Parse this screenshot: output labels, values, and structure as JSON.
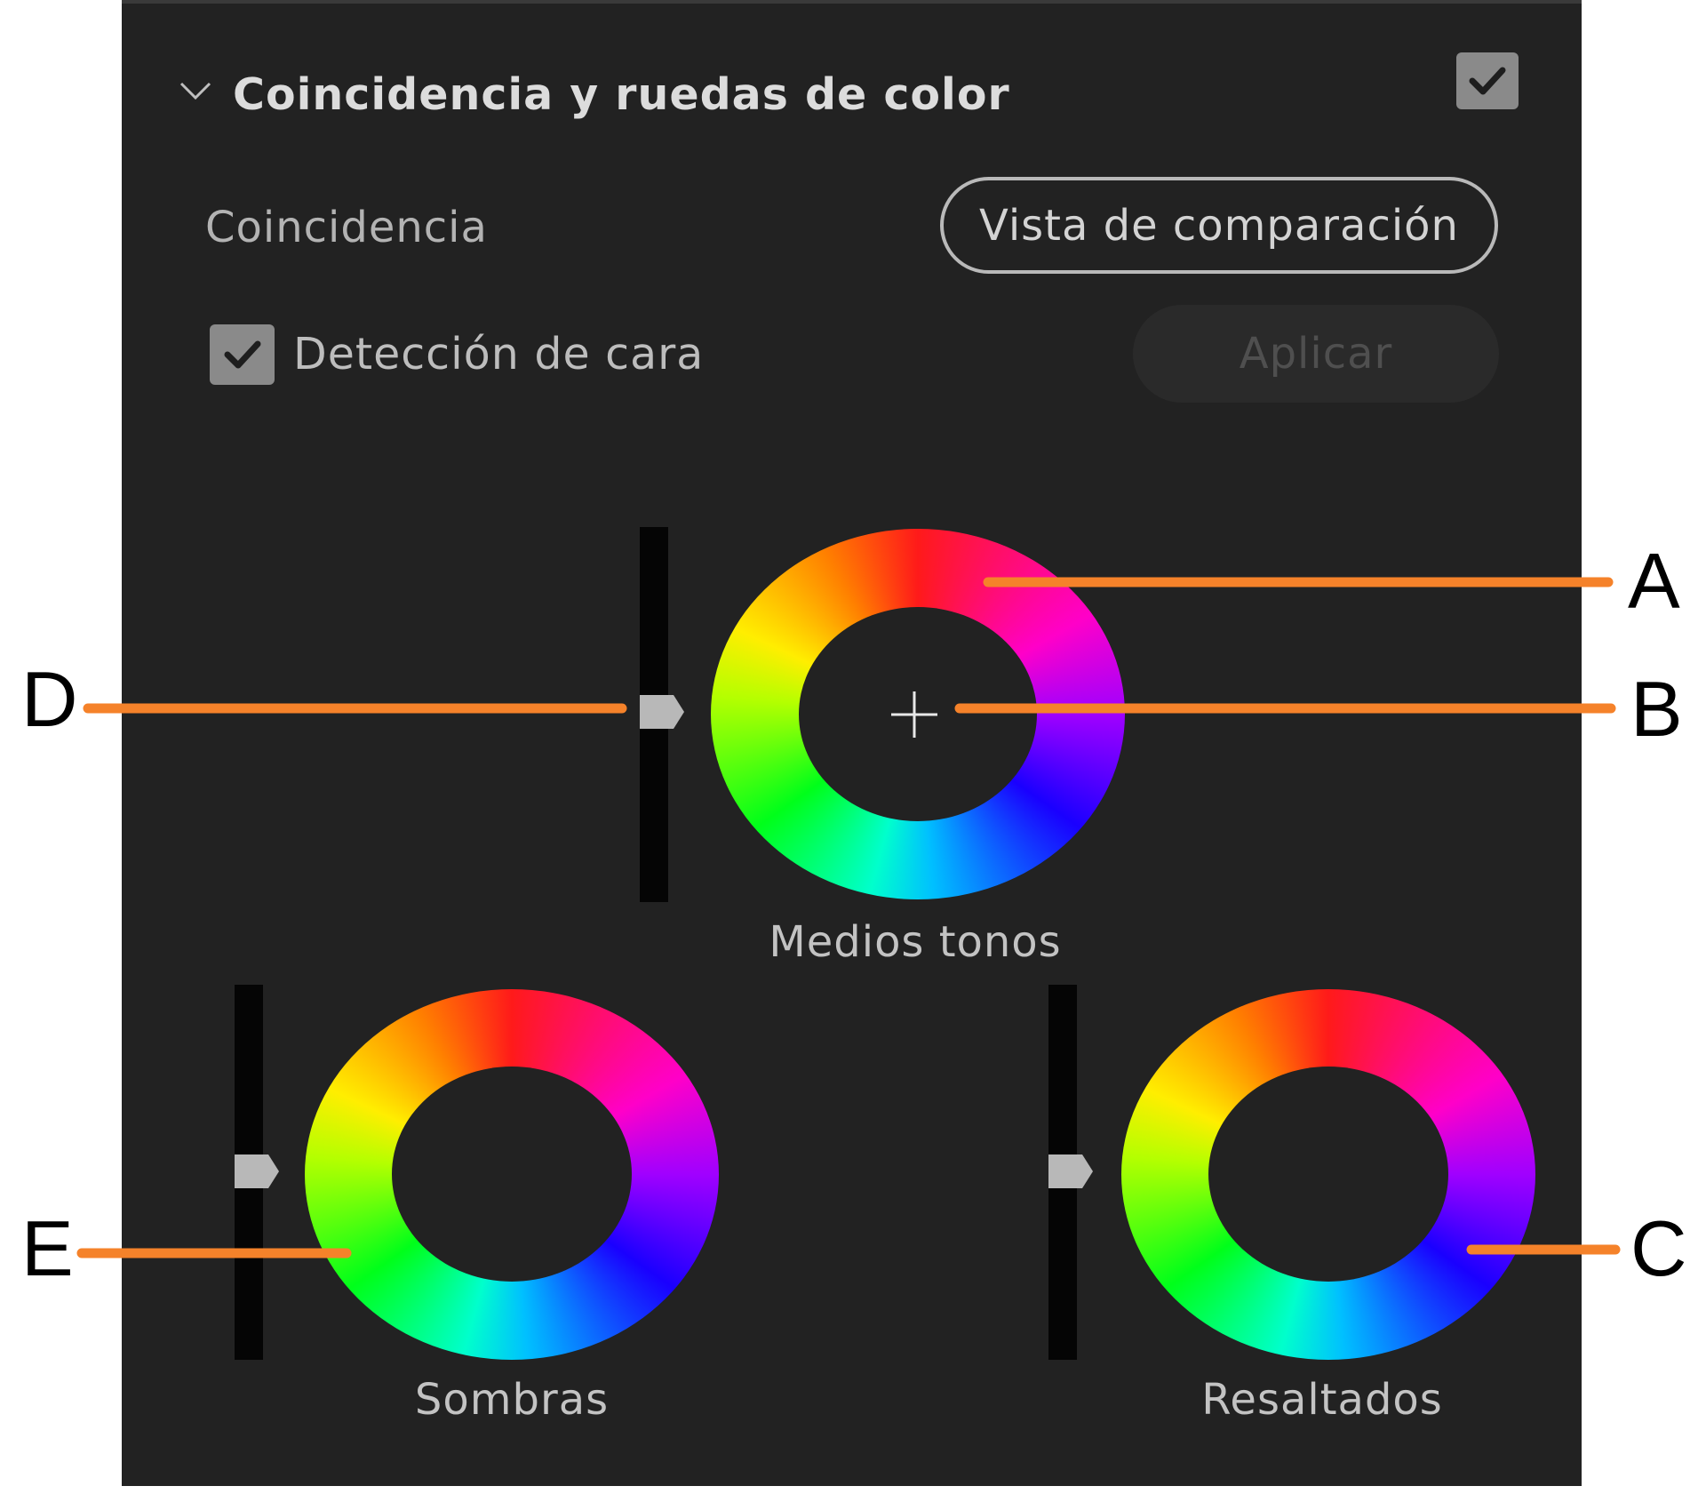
{
  "panel": {
    "section_title": "Coincidencia y ruedas de color",
    "section_enabled": true,
    "match_label": "Coincidencia",
    "compare_button_label": "Vista de comparación",
    "face_detection_label": "Detección de cara",
    "face_detection_checked": true,
    "apply_button_label": "Aplicar",
    "apply_enabled": false
  },
  "wheels": {
    "midtones": {
      "label": "Medios tonos",
      "has_crosshair": true
    },
    "shadows": {
      "label": "Sombras"
    },
    "highlights": {
      "label": "Resaltados"
    }
  },
  "callouts": {
    "a": "A",
    "b": "B",
    "c": "C",
    "d": "D",
    "e": "E",
    "line_color": "#f5822a"
  },
  "colors": {
    "panel_bg": "#222222",
    "text_primary": "#dcdcdc",
    "text_secondary": "#b3b3b3",
    "checkbox_bg": "#8a8a8a",
    "slider_track": "#050505",
    "slider_thumb": "#b8b8b8"
  },
  "icons": {
    "chevron": "chevron-down-icon",
    "check": "checkmark-icon",
    "crosshair": "crosshair-icon"
  }
}
